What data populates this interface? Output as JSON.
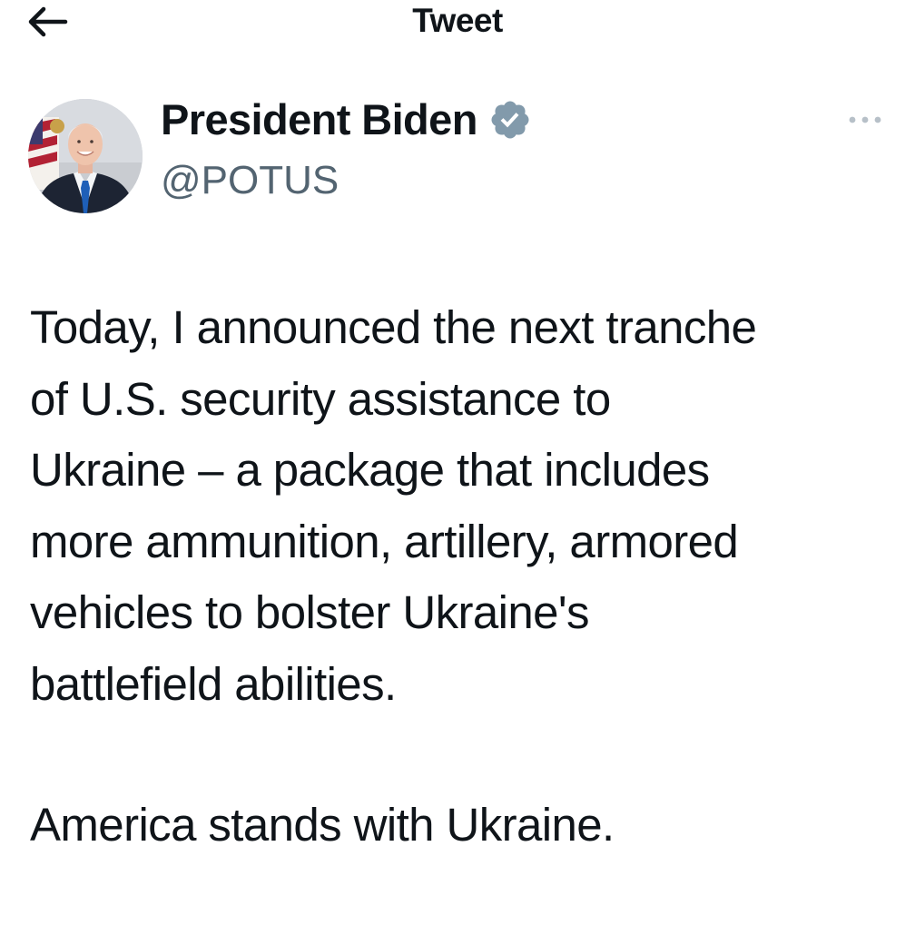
{
  "header": {
    "title": "Tweet",
    "back_icon": "arrow-left-icon"
  },
  "author": {
    "display_name": "President Biden",
    "handle": "@POTUS",
    "verified_icon": "verified-badge-icon",
    "verified_color": "#829aab",
    "more_icon": "more-horizontal-icon"
  },
  "tweet": {
    "lines": [
      "Today, I announced the next tranche",
      "of U.S. security assistance to",
      "Ukraine – a package that includes",
      "more ammunition, artillery, armored",
      "vehicles to bolster Ukraine's",
      "battlefield abilities."
    ],
    "closing": "America stands with Ukraine."
  },
  "colors": {
    "text_primary": "#0f1419",
    "text_secondary": "#536471",
    "background": "#ffffff"
  }
}
